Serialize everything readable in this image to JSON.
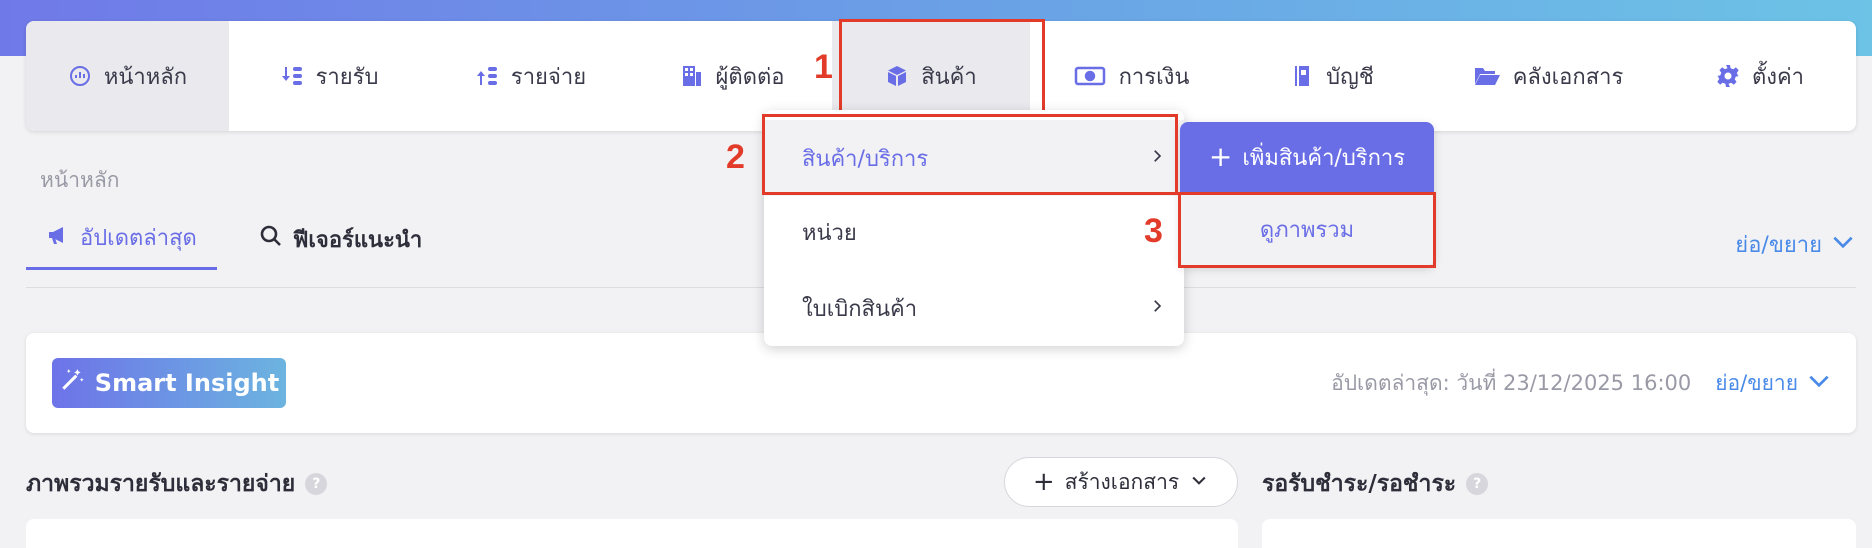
{
  "colors": {
    "accent": "#6a6ee6",
    "link": "#4a8ae8",
    "highlight": "#e23b2a",
    "gradient_start": "#7079e8",
    "gradient_end": "#6cc3e6"
  },
  "nav": {
    "items": [
      {
        "label": "หน้าหลัก",
        "icon": "dashboard-gauge-icon"
      },
      {
        "label": "รายรับ",
        "icon": "income-arrows-icon"
      },
      {
        "label": "รายจ่าย",
        "icon": "expense-arrows-icon"
      },
      {
        "label": "ผู้ติดต่อ",
        "icon": "building-icon"
      },
      {
        "label": "สินค้า",
        "icon": "box-icon"
      },
      {
        "label": "การเงิน",
        "icon": "money-icon"
      },
      {
        "label": "บัญชี",
        "icon": "ledger-book-icon"
      },
      {
        "label": "คลังเอกสาร",
        "icon": "folder-open-icon"
      },
      {
        "label": "ตั้งค่า",
        "icon": "gear-icon"
      }
    ]
  },
  "steps": [
    "1",
    "2",
    "3"
  ],
  "breadcrumb": "หน้าหลัก",
  "tabs": [
    {
      "label": "อัปเดตล่าสุด",
      "icon": "megaphone-icon"
    },
    {
      "label": "ฟีเจอร์แนะนำ",
      "icon": "search-icon"
    }
  ],
  "collapse_label": "ย่อ/ขยาย",
  "dropdown": {
    "items": [
      {
        "label": "สินค้า/บริการ",
        "has_submenu": true
      },
      {
        "label": "หน่วย",
        "has_submenu": false
      },
      {
        "label": "ใบเบิกสินค้า",
        "has_submenu": true
      }
    ],
    "submenu": {
      "add_label": "เพิ่มสินค้า/บริการ",
      "view_label": "ดูภาพรวม"
    }
  },
  "insight": {
    "button_label": "Smart Insight",
    "updated_text": "อัปเดตล่าสุด: วันที่ 23/12/2025 16:00",
    "toggle_label": "ย่อ/ขยาย"
  },
  "overview": {
    "title": "ภาพรวมรายรับและรายจ่าย",
    "create_doc_label": "สร้างเอกสาร",
    "pending_title": "รอรับชำระ/รอชำระ",
    "help": "?"
  }
}
